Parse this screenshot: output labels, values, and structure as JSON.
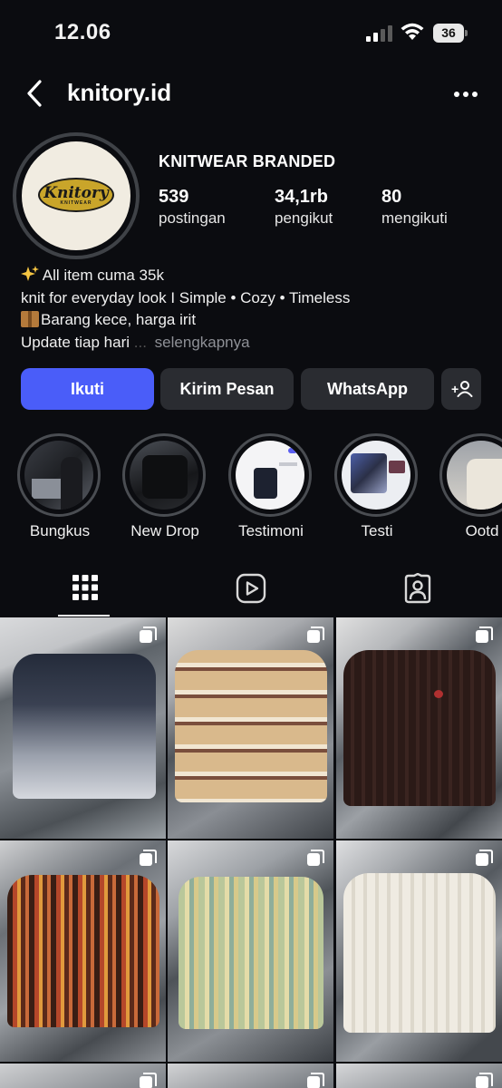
{
  "status": {
    "time": "12.06",
    "battery": "36"
  },
  "header": {
    "username": "knitory.id"
  },
  "profile": {
    "avatar_text": "Knitory",
    "avatar_subtext": "KNITWEAR",
    "fullname": "KNITWEAR BRANDED",
    "stats": [
      {
        "value": "539",
        "label": "postingan"
      },
      {
        "value": "34,1rb",
        "label": "pengikut"
      },
      {
        "value": "80",
        "label": "mengikuti"
      }
    ]
  },
  "bio": {
    "line1": "All item cuma 35k",
    "line2": "knit for everyday look I Simple • Cozy • Timeless",
    "line3": "Barang kece, harga irit",
    "line4": "Update tiap hari",
    "ellipsis": "...",
    "more": "selengkapnya"
  },
  "actions": {
    "follow": "Ikuti",
    "message": "Kirim Pesan",
    "whatsapp": "WhatsApp"
  },
  "highlights": [
    {
      "label": "Bungkus"
    },
    {
      "label": "New Drop"
    },
    {
      "label": "Testimoni"
    },
    {
      "label": "Testi"
    },
    {
      "label": "Ootd"
    }
  ],
  "tabs": [
    {
      "icon": "grid-icon"
    },
    {
      "icon": "reels-icon"
    },
    {
      "icon": "tagged-icon"
    }
  ],
  "colors": {
    "background": "#0b0c10",
    "follow_button": "#4a5df9",
    "secondary_button": "#2a2c31",
    "muted_text": "#8e9096"
  }
}
